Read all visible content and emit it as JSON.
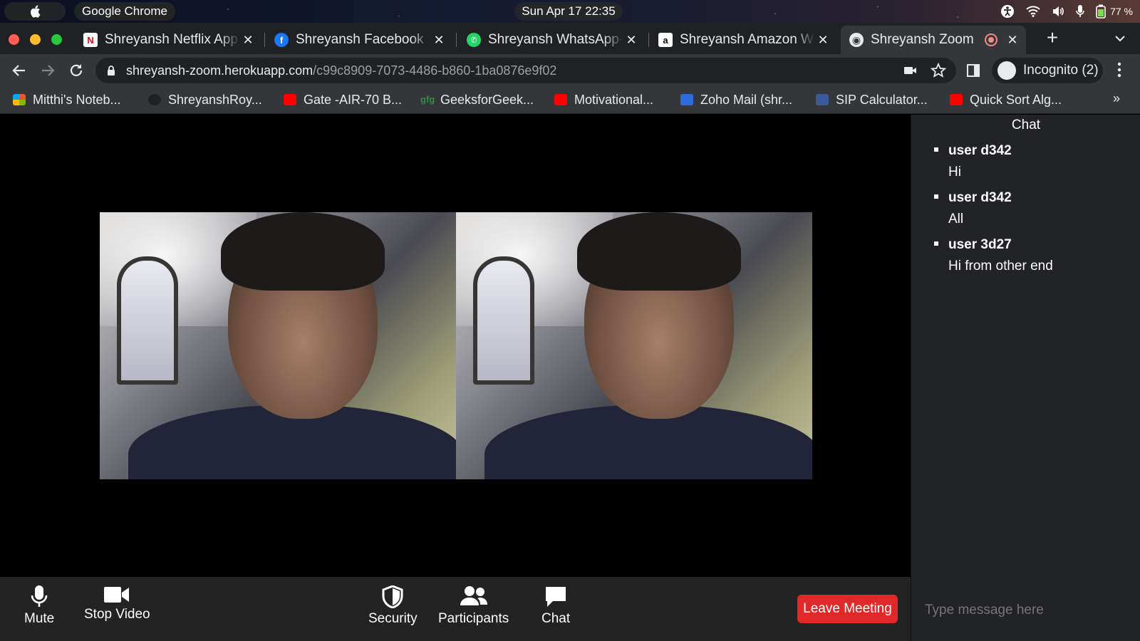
{
  "menubar": {
    "app_name": "Google Chrome",
    "datetime": "Sun Apr 17  22:35",
    "battery": "77 %"
  },
  "tabs": [
    {
      "title": "Shreyansh Netflix App",
      "favicon": "netflix-icon",
      "color": "#e50914",
      "glyph": "N"
    },
    {
      "title": "Shreyansh Facebook",
      "favicon": "facebook-icon",
      "color": "#1877f2",
      "glyph": "f"
    },
    {
      "title": "Shreyansh WhatsApp-",
      "favicon": "whatsapp-icon",
      "color": "#25d366",
      "glyph": "✆"
    },
    {
      "title": "Shreyansh Amazon We",
      "favicon": "amazon-icon",
      "color": "#ffffff",
      "glyph": "a"
    },
    {
      "title": "Shreyansh Zoom",
      "favicon": "globe-icon",
      "color": "#e8eaed",
      "glyph": "◉"
    }
  ],
  "toolbar": {
    "url_host": "shreyansh-zoom.herokuapp.com",
    "url_path": "/c99c8909-7073-4486-b860-1ba0876e9f02",
    "incognito_label": "Incognito (2)"
  },
  "bookmarks": [
    {
      "label": "Mitthi's Noteb...",
      "icon": "microsoft-icon"
    },
    {
      "label": "ShreyanshRoy...",
      "icon": "github-icon"
    },
    {
      "label": "Gate -AIR-70 B...",
      "icon": "youtube-icon"
    },
    {
      "label": "GeeksforGeek...",
      "icon": "gfg-icon"
    },
    {
      "label": "Motivational...",
      "icon": "youtube-icon"
    },
    {
      "label": "Zoho Mail (shr...",
      "icon": "zoho-icon"
    },
    {
      "label": "SIP Calculator...",
      "icon": "sip-icon"
    },
    {
      "label": "Quick Sort Alg...",
      "icon": "youtube-icon"
    }
  ],
  "chat": {
    "title": "Chat",
    "messages": [
      {
        "user": "user d342",
        "text": "Hi"
      },
      {
        "user": "user d342",
        "text": "All"
      },
      {
        "user": "user 3d27",
        "text": "Hi from other end"
      }
    ],
    "input_placeholder": "Type message here"
  },
  "controls": {
    "mute": "Mute",
    "stop_video": "Stop Video",
    "security": "Security",
    "participants": "Participants",
    "chat": "Chat",
    "leave": "Leave Meeting"
  }
}
